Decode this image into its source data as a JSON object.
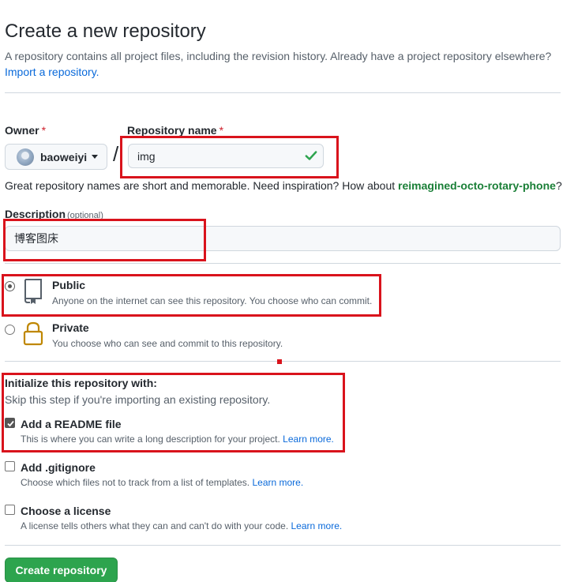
{
  "header": {
    "title": "Create a new repository",
    "subtitle": "A repository contains all project files, including the revision history. Already have a project repository elsewhere?",
    "import_link": "Import a repository."
  },
  "owner": {
    "label": "Owner",
    "required_mark": "*",
    "selected": "baoweiyi"
  },
  "repo_name": {
    "label": "Repository name",
    "required_mark": "*",
    "value": "img",
    "slash": "/"
  },
  "hint": {
    "text": "Great repository names are short and memorable. Need inspiration? How about ",
    "suggestion": "reimagined-octo-rotary-phone",
    "suffix": "?"
  },
  "description": {
    "label": "Description",
    "optional": "(optional)",
    "value": "博客图床"
  },
  "visibility": {
    "public_title": "Public",
    "public_desc": "Anyone on the internet can see this repository. You choose who can commit.",
    "private_title": "Private",
    "private_desc": "You choose who can see and commit to this repository.",
    "selected": "Public"
  },
  "init": {
    "title": "Initialize this repository with:",
    "subtitle": "Skip this step if you're importing an existing repository.",
    "readme_title": "Add a README file",
    "readme_desc": "This is where you can write a long description for your project.",
    "gitignore_title": "Add .gitignore",
    "gitignore_desc": "Choose which files not to track from a list of templates.",
    "license_title": "Choose a license",
    "license_desc": "A license tells others what they can and can't do with your code.",
    "learn_more": "Learn more."
  },
  "submit": {
    "label": "Create repository"
  },
  "colors": {
    "accent_link": "#0969da",
    "success_green": "#1a7f37",
    "button_green": "#2da44e",
    "highlight_red": "#d9131c",
    "lock_gold": "#bf8700"
  }
}
